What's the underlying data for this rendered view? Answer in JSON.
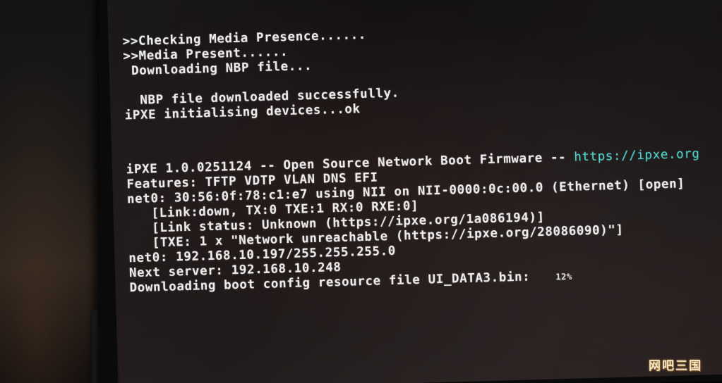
{
  "terminal": {
    "lines": [
      ">>Checking Media Presence......",
      ">>Media Present......",
      " Downloading NBP file...",
      "",
      "  NBP file downloaded successfully.",
      "iPXE initialising devices...ok",
      "iPXE 1.0.0251124 -- Open Source Network Boot Firmware -- ",
      "https://ipxe.org",
      "Features: TFTP VDTP VLAN DNS EFI",
      "net0: 30:56:0f:78:c1:e7 using NII on NII-0000:0c:00.0 (Ethernet) [open]",
      "[Link:down, TX:0 TXE:1 RX:0 RXE:0]",
      "[Link status: Unknown (https://ipxe.org/1a086194)]",
      "[TXE: 1 x \"Network unreachable (https://ipxe.org/28086090)\"]",
      "net0: 192.168.10.197/255.255.255.0",
      "Next server: 192.168.10.248",
      "Downloading boot config resource file UI_DATA3.bin:"
    ],
    "progress_text": "12%",
    "progress_value": 12
  },
  "watermark": {
    "text": "网吧三国"
  },
  "colors": {
    "text": "#ecebea",
    "link": "#4fd0c8",
    "background": "#171315"
  }
}
